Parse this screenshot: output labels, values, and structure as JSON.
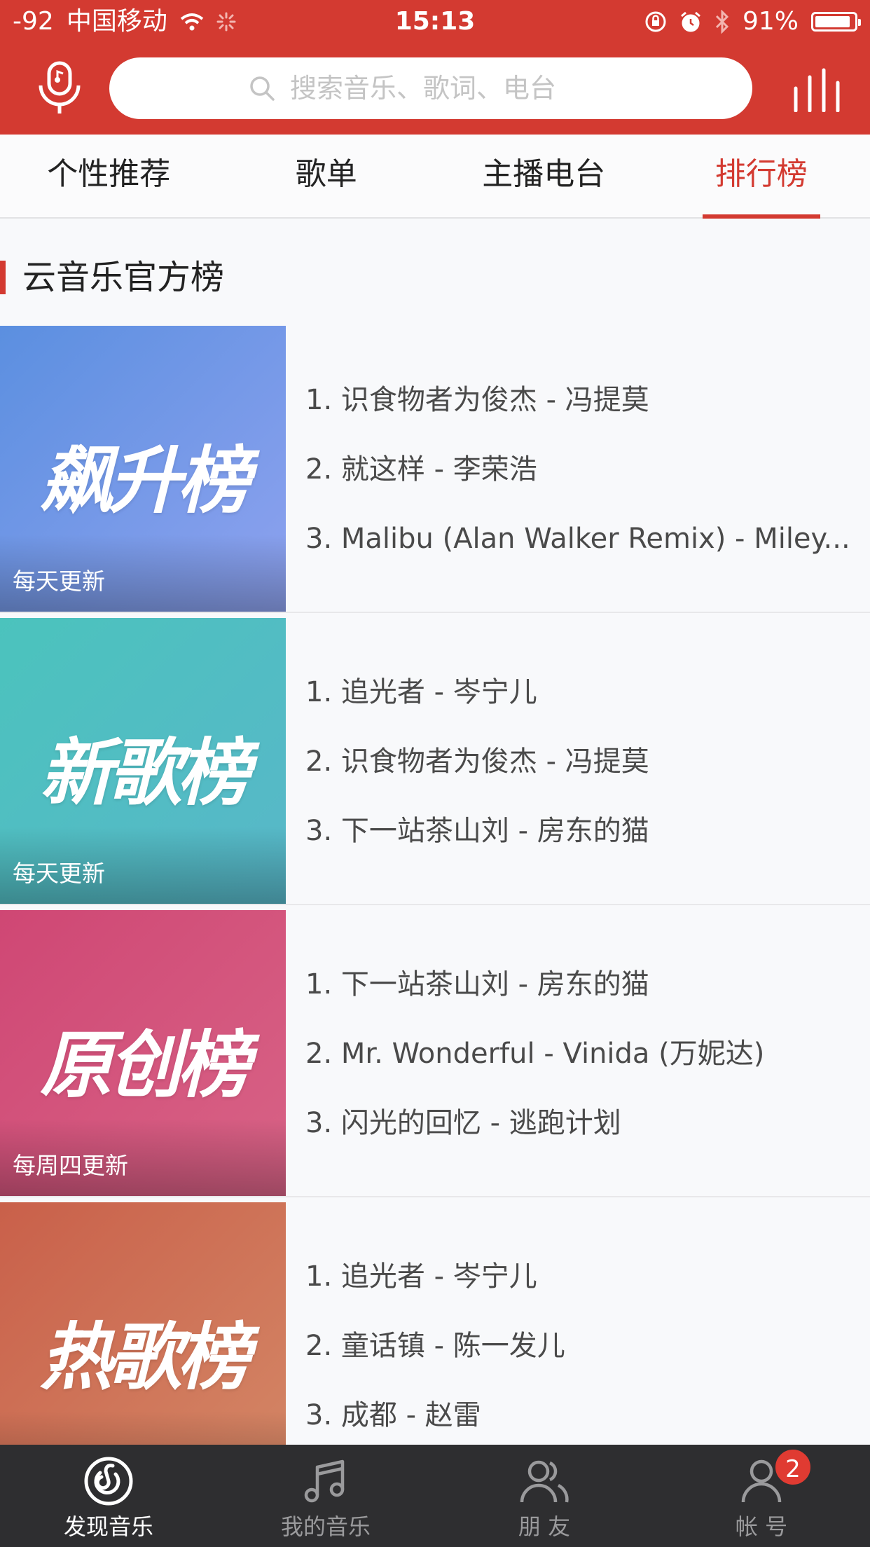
{
  "status_bar": {
    "signal": "-92",
    "carrier": "中国移动",
    "time": "15:13",
    "battery": "91%",
    "battery_level": 0.91
  },
  "search": {
    "placeholder": "搜索音乐、歌词、电台"
  },
  "tabs": [
    {
      "label": "个性推荐",
      "active": false
    },
    {
      "label": "歌单",
      "active": false
    },
    {
      "label": "主播电台",
      "active": false
    },
    {
      "label": "排行榜",
      "active": true
    }
  ],
  "section": {
    "title": "云音乐官方榜"
  },
  "charts": [
    {
      "cover_title": "飙升榜",
      "update": "每天更新",
      "colors": [
        "#5b8fe0",
        "#8ea2ef"
      ],
      "songs": [
        "1. 识食物者为俊杰 - 冯提莫",
        "2. 就这样 - 李荣浩",
        "3. Malibu (Alan Walker Remix) - Miley..."
      ]
    },
    {
      "cover_title": "新歌榜",
      "update": "每天更新",
      "colors": [
        "#4bc3bd",
        "#58b7c9"
      ],
      "songs": [
        "1. 追光者 - 岑宁儿",
        "2. 识食物者为俊杰 - 冯提莫",
        "3. 下一站茶山刘 - 房东的猫"
      ]
    },
    {
      "cover_title": "原创榜",
      "update": "每周四更新",
      "colors": [
        "#cf4774",
        "#d86386"
      ],
      "songs": [
        "1. 下一站茶山刘 - 房东的猫",
        "2. Mr. Wonderful - Vinida (万妮达)",
        "3. 闪光的回忆 - 逃跑计划"
      ]
    },
    {
      "cover_title": "热歌榜",
      "update": "",
      "colors": [
        "#c9604a",
        "#d48766"
      ],
      "songs": [
        "1. 追光者 - 岑宁儿",
        "2. 童话镇 - 陈一发儿",
        "3. 成都 - 赵雷"
      ]
    }
  ],
  "bottom_nav": [
    {
      "label": "发现音乐",
      "icon": "netease-music-icon",
      "active": true
    },
    {
      "label": "我的音乐",
      "icon": "music-note-icon",
      "active": false
    },
    {
      "label": "朋 友",
      "icon": "friends-icon",
      "active": false
    },
    {
      "label": "帐 号",
      "icon": "account-icon",
      "active": false,
      "badge": "2"
    }
  ],
  "theme": {
    "accent": "#d33a31",
    "nav_background": "#2e2e30"
  }
}
